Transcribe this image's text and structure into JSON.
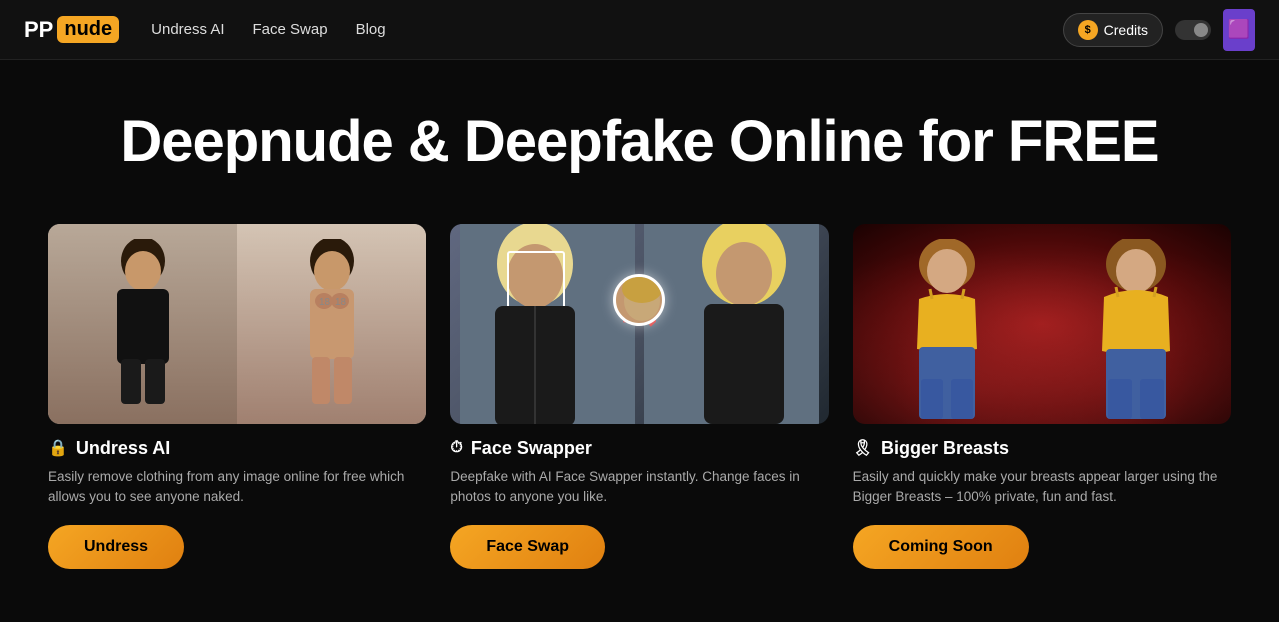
{
  "nav": {
    "logo_pp": "PP",
    "logo_nude": "nude",
    "links": [
      {
        "id": "undress-ai",
        "label": "Undress AI"
      },
      {
        "id": "face-swap",
        "label": "Face Swap"
      },
      {
        "id": "blog",
        "label": "Blog"
      }
    ],
    "credits_label": "Credits",
    "coin_symbol": "$"
  },
  "hero": {
    "headline": "Deepnude & Deepfake Online for FREE"
  },
  "cards": [
    {
      "id": "undress",
      "icon": "🔒",
      "title": "Undress AI",
      "description": "Easily remove clothing from any image online for free which allows you to see anyone naked.",
      "btn_label": "Undress"
    },
    {
      "id": "face-swap",
      "icon": "⏱",
      "title": "Face Swapper",
      "description": "Deepfake with AI Face Swapper instantly. Change faces in photos to anyone you like.",
      "btn_label": "Face Swap"
    },
    {
      "id": "bigger-breasts",
      "icon": "8",
      "title": "Bigger Breasts",
      "description": "Easily and quickly make your breasts appear larger using the Bigger Breasts – 100% private, fun and fast.",
      "btn_label": "Coming Soon"
    }
  ]
}
